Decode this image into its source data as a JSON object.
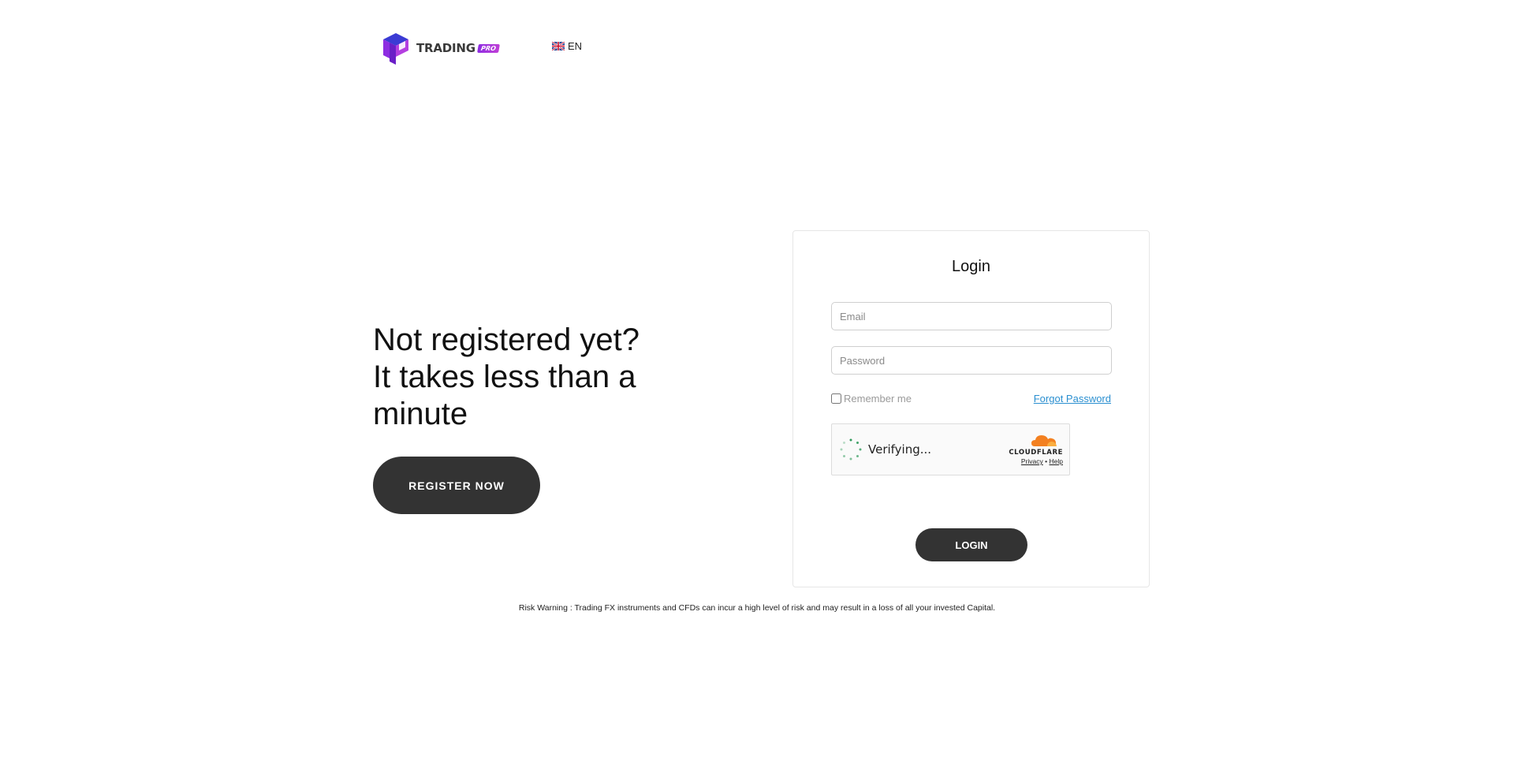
{
  "header": {
    "logo_word": "TRADING",
    "logo_badge": "PRO",
    "language": "EN",
    "language_flag": "uk-flag-icon"
  },
  "promo": {
    "heading_line1": "Not registered yet?",
    "heading_line2": "It takes less than a",
    "heading_line3": "minute",
    "register_label": "REGISTER NOW"
  },
  "login": {
    "title": "Login",
    "email_placeholder": "Email",
    "email_value": "",
    "password_placeholder": "Password",
    "password_value": "",
    "remember_label": "Remember me",
    "remember_checked": false,
    "forgot_label": "Forgot Password",
    "captcha": {
      "status": "Verifying...",
      "provider": "CLOUDFLARE",
      "privacy_label": "Privacy",
      "separator": "•",
      "help_label": "Help"
    },
    "login_label": "LOGIN"
  },
  "footer": {
    "risk_warning": "Risk Warning : Trading FX instruments and CFDs can incur a high level of risk and may result in a loss of all your invested Capital."
  },
  "colors": {
    "button_bg": "#333333",
    "link": "#2a8fd0",
    "logo_purple": "#8e2de2",
    "logo_blue": "#3b3bd4",
    "cloudflare_orange": "#f38020",
    "spinner_green": "#2e9a5a"
  }
}
